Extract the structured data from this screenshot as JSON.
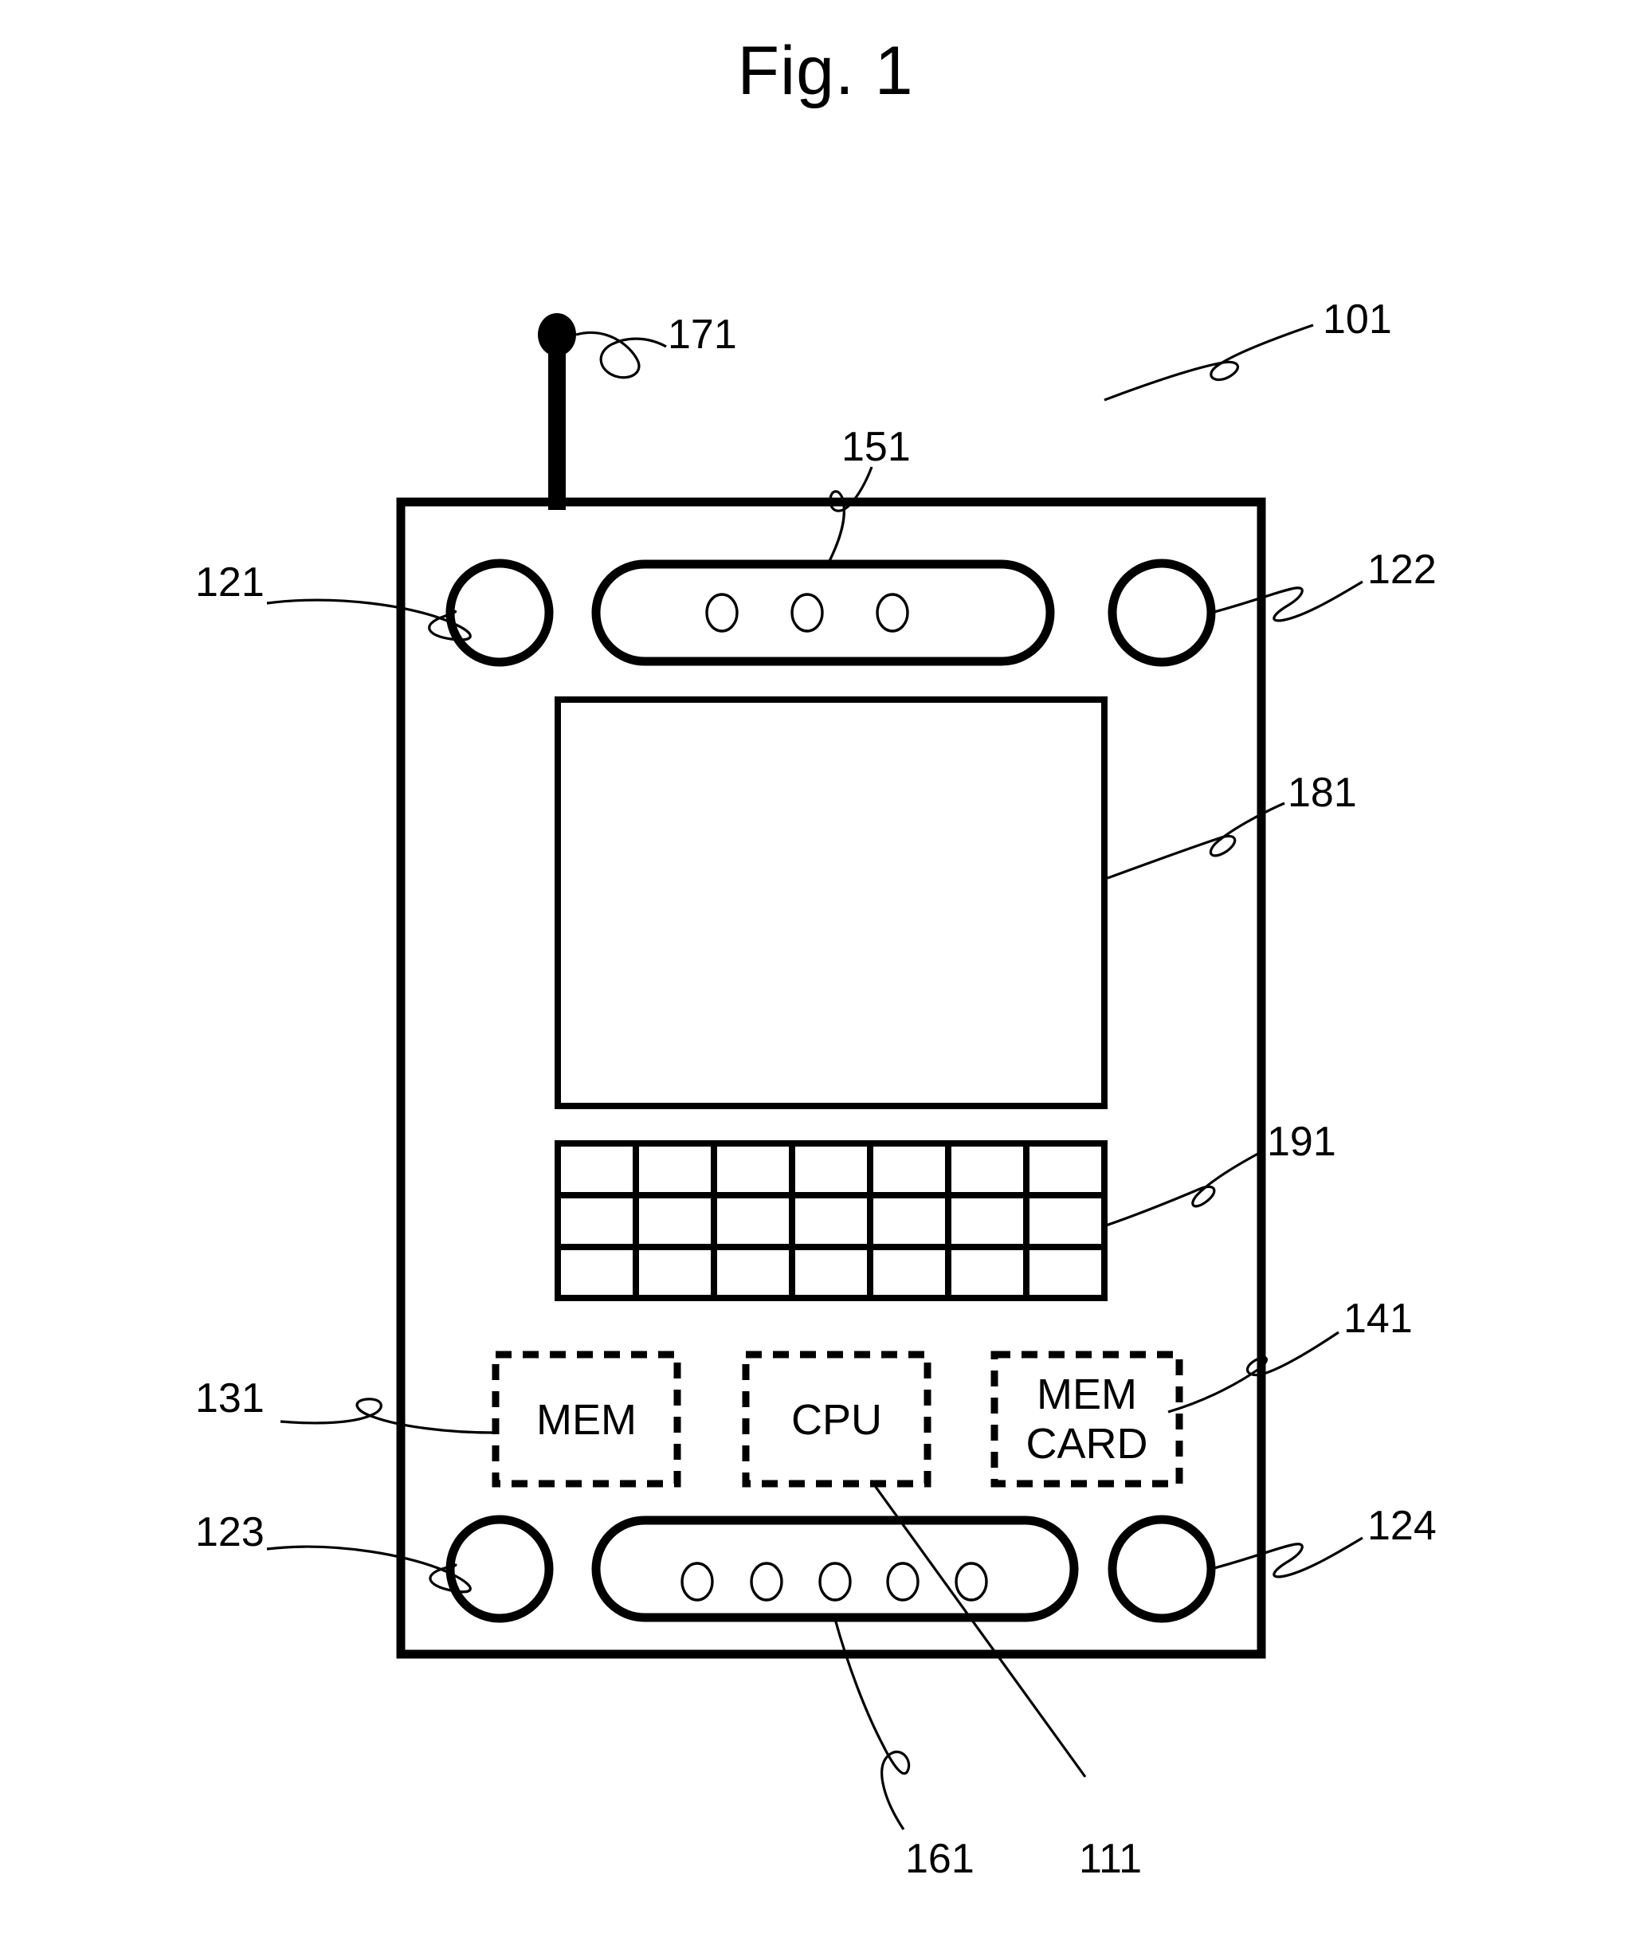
{
  "figure": {
    "title": "Fig. 1",
    "type": "patent-figure",
    "description": "Schematic front view of a portable wireless communication device"
  },
  "device": {
    "body_label": "101",
    "components": {
      "antenna": {
        "ref": "171",
        "name": "antenna"
      },
      "earpiece_speaker": {
        "ref": "151",
        "name": "speaker",
        "hole_count": 3
      },
      "display": {
        "ref": "181",
        "name": "display-screen"
      },
      "keypad": {
        "ref": "191",
        "name": "keypad",
        "columns": 7,
        "rows": 3
      },
      "microphone": {
        "ref": "161",
        "name": "microphone",
        "hole_count": 5
      },
      "corner_top_left": {
        "ref": "121",
        "name": "corner-element-top-left"
      },
      "corner_top_right": {
        "ref": "122",
        "name": "corner-element-top-right"
      },
      "corner_bottom_left": {
        "ref": "123",
        "name": "corner-element-bottom-left"
      },
      "corner_bottom_right": {
        "ref": "124",
        "name": "corner-element-bottom-right"
      }
    },
    "blocks": [
      {
        "ref": "131",
        "label": "MEM",
        "name": "memory-block"
      },
      {
        "ref": "111",
        "label": "CPU",
        "name": "cpu-block"
      },
      {
        "ref": "141",
        "label": "MEM\nCARD",
        "label_line1": "MEM",
        "label_line2": "CARD",
        "name": "memory-card-block"
      }
    ]
  },
  "reference_numerals": {
    "n101": "101",
    "n111": "111",
    "n121": "121",
    "n122": "122",
    "n123": "123",
    "n124": "124",
    "n131": "131",
    "n141": "141",
    "n151": "151",
    "n161": "161",
    "n171": "171",
    "n181": "181",
    "n191": "191"
  },
  "block_labels": {
    "mem": "MEM",
    "cpu": "CPU",
    "memcard_line1": "MEM",
    "memcard_line2": "CARD"
  },
  "colors": {
    "ink": "#000000",
    "paper": "#ffffff"
  }
}
